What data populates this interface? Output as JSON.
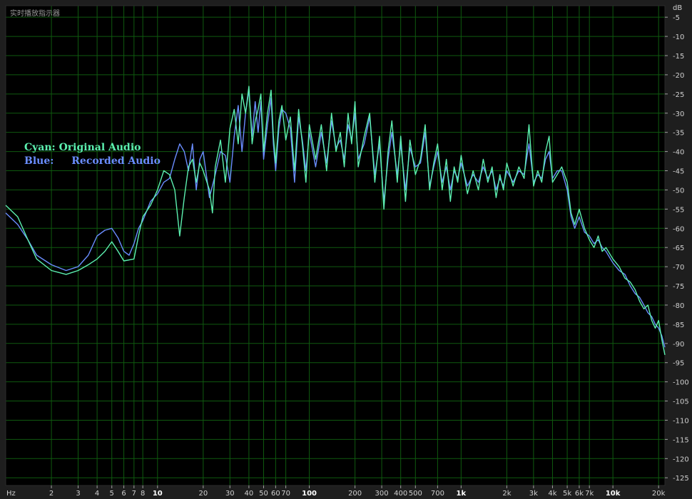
{
  "window": {
    "title": "实时播放指示器"
  },
  "legend": {
    "cyan_key": "Cyan:",
    "cyan_label": "Original Audio",
    "blue_key": "Blue:",
    "blue_label": "Recorded Audio"
  },
  "colors": {
    "cyan": "#5cf0b0",
    "blue": "#6a8dff",
    "grid": "#0f5a0f",
    "background": "#000000"
  },
  "chart_data": {
    "type": "line",
    "xscale": "log",
    "xunit": "Hz",
    "yunit": "dB",
    "xlim": [
      1,
      22000
    ],
    "ylim": [
      -127,
      -2
    ],
    "grid": true,
    "legend_position": "left",
    "x_ticks": [
      {
        "v": 2,
        "label": "2"
      },
      {
        "v": 3,
        "label": "3"
      },
      {
        "v": 4,
        "label": "4"
      },
      {
        "v": 5,
        "label": "5"
      },
      {
        "v": 6,
        "label": "6"
      },
      {
        "v": 7,
        "label": "7"
      },
      {
        "v": 8,
        "label": "8"
      },
      {
        "v": 10,
        "label": "10",
        "bold": true
      },
      {
        "v": 20,
        "label": "20"
      },
      {
        "v": 30,
        "label": "30"
      },
      {
        "v": 40,
        "label": "40"
      },
      {
        "v": 50,
        "label": "50"
      },
      {
        "v": 60,
        "label": "60"
      },
      {
        "v": 70,
        "label": "70"
      },
      {
        "v": 100,
        "label": "100",
        "bold": true
      },
      {
        "v": 200,
        "label": "200"
      },
      {
        "v": 300,
        "label": "300"
      },
      {
        "v": 400,
        "label": "400"
      },
      {
        "v": 500,
        "label": "500"
      },
      {
        "v": 700,
        "label": "700"
      },
      {
        "v": 1000,
        "label": "1k",
        "bold": true
      },
      {
        "v": 2000,
        "label": "2k"
      },
      {
        "v": 3000,
        "label": "3k"
      },
      {
        "v": 4000,
        "label": "4k"
      },
      {
        "v": 5000,
        "label": "5k"
      },
      {
        "v": 6000,
        "label": "6k"
      },
      {
        "v": 7000,
        "label": "7k"
      },
      {
        "v": 10000,
        "label": "10k",
        "bold": true
      },
      {
        "v": 20000,
        "label": "20k"
      }
    ],
    "y_ticks": [
      -5,
      -10,
      -15,
      -20,
      -25,
      -30,
      -35,
      -40,
      -45,
      -50,
      -55,
      -60,
      -65,
      -70,
      -75,
      -80,
      -85,
      -90,
      -95,
      -100,
      -105,
      -110,
      -115,
      -120,
      -125
    ],
    "series": [
      {
        "name": "Original Audio",
        "color": "#5cf0b0",
        "points": [
          [
            1,
            -54
          ],
          [
            1.2,
            -57
          ],
          [
            1.4,
            -63
          ],
          [
            1.6,
            -68
          ],
          [
            2,
            -71
          ],
          [
            2.5,
            -72
          ],
          [
            3,
            -71
          ],
          [
            3.5,
            -69.5
          ],
          [
            4,
            -68
          ],
          [
            4.5,
            -66
          ],
          [
            5,
            -63.5
          ],
          [
            5.5,
            -66
          ],
          [
            6,
            -68.5
          ],
          [
            7,
            -68
          ],
          [
            7.5,
            -62
          ],
          [
            8,
            -57
          ],
          [
            9,
            -54
          ],
          [
            10,
            -50
          ],
          [
            11,
            -45
          ],
          [
            12,
            -46
          ],
          [
            13,
            -50
          ],
          [
            14,
            -62
          ],
          [
            15,
            -52
          ],
          [
            16,
            -44
          ],
          [
            17,
            -42
          ],
          [
            18,
            -48
          ],
          [
            19,
            -43
          ],
          [
            20,
            -45
          ],
          [
            22,
            -50
          ],
          [
            23,
            -56
          ],
          [
            24,
            -44
          ],
          [
            26,
            -37
          ],
          [
            28,
            -48
          ],
          [
            30,
            -34
          ],
          [
            32,
            -29
          ],
          [
            34,
            -38
          ],
          [
            36,
            -25
          ],
          [
            38,
            -30
          ],
          [
            40,
            -23
          ],
          [
            42,
            -38
          ],
          [
            44,
            -32
          ],
          [
            46,
            -29
          ],
          [
            48,
            -25
          ],
          [
            50,
            -40
          ],
          [
            53,
            -30
          ],
          [
            56,
            -24
          ],
          [
            58,
            -36
          ],
          [
            60,
            -43
          ],
          [
            63,
            -32
          ],
          [
            66,
            -28
          ],
          [
            70,
            -37
          ],
          [
            75,
            -31
          ],
          [
            80,
            -45
          ],
          [
            85,
            -29
          ],
          [
            90,
            -38
          ],
          [
            95,
            -48
          ],
          [
            100,
            -33
          ],
          [
            110,
            -42
          ],
          [
            120,
            -33
          ],
          [
            130,
            -45
          ],
          [
            140,
            -30
          ],
          [
            150,
            -40
          ],
          [
            160,
            -35
          ],
          [
            170,
            -44
          ],
          [
            180,
            -30
          ],
          [
            190,
            -38
          ],
          [
            200,
            -27
          ],
          [
            210,
            -44
          ],
          [
            230,
            -36
          ],
          [
            250,
            -30
          ],
          [
            270,
            -48
          ],
          [
            290,
            -36
          ],
          [
            310,
            -55
          ],
          [
            330,
            -40
          ],
          [
            350,
            -32
          ],
          [
            380,
            -48
          ],
          [
            400,
            -36
          ],
          [
            430,
            -53
          ],
          [
            460,
            -37
          ],
          [
            500,
            -46
          ],
          [
            540,
            -42
          ],
          [
            580,
            -33
          ],
          [
            620,
            -50
          ],
          [
            660,
            -43
          ],
          [
            700,
            -38
          ],
          [
            750,
            -50
          ],
          [
            800,
            -42
          ],
          [
            850,
            -53
          ],
          [
            900,
            -44
          ],
          [
            950,
            -48
          ],
          [
            1000,
            -41
          ],
          [
            1100,
            -51
          ],
          [
            1200,
            -45
          ],
          [
            1300,
            -50
          ],
          [
            1400,
            -42
          ],
          [
            1500,
            -48
          ],
          [
            1600,
            -44
          ],
          [
            1700,
            -52
          ],
          [
            1800,
            -46
          ],
          [
            1900,
            -50
          ],
          [
            2000,
            -43
          ],
          [
            2200,
            -49
          ],
          [
            2400,
            -44
          ],
          [
            2600,
            -47
          ],
          [
            2800,
            -33
          ],
          [
            3000,
            -49
          ],
          [
            3200,
            -45
          ],
          [
            3400,
            -48
          ],
          [
            3600,
            -40
          ],
          [
            3800,
            -36
          ],
          [
            4000,
            -48
          ],
          [
            4300,
            -46
          ],
          [
            4600,
            -44
          ],
          [
            5000,
            -48
          ],
          [
            5300,
            -56
          ],
          [
            5600,
            -59
          ],
          [
            6000,
            -55
          ],
          [
            6500,
            -60
          ],
          [
            7000,
            -63
          ],
          [
            7500,
            -65
          ],
          [
            8000,
            -62
          ],
          [
            8500,
            -66
          ],
          [
            9000,
            -65
          ],
          [
            10000,
            -68
          ],
          [
            11000,
            -70
          ],
          [
            12000,
            -73
          ],
          [
            13000,
            -74
          ],
          [
            14000,
            -76
          ],
          [
            15000,
            -79
          ],
          [
            16000,
            -81
          ],
          [
            17000,
            -80
          ],
          [
            18000,
            -84
          ],
          [
            19000,
            -86
          ],
          [
            20000,
            -84
          ],
          [
            21000,
            -89
          ],
          [
            22000,
            -93
          ]
        ]
      },
      {
        "name": "Recorded Audio",
        "color": "#6a8dff",
        "points": [
          [
            1,
            -56
          ],
          [
            1.2,
            -59
          ],
          [
            1.4,
            -63
          ],
          [
            1.6,
            -67
          ],
          [
            2,
            -69.5
          ],
          [
            2.5,
            -71
          ],
          [
            3,
            -70
          ],
          [
            3.5,
            -67
          ],
          [
            4,
            -62
          ],
          [
            4.5,
            -60.5
          ],
          [
            5,
            -60
          ],
          [
            5.5,
            -62.5
          ],
          [
            6,
            -66
          ],
          [
            6.5,
            -67
          ],
          [
            7,
            -64
          ],
          [
            7.5,
            -60
          ],
          [
            8,
            -58
          ],
          [
            9,
            -53
          ],
          [
            10,
            -51
          ],
          [
            11,
            -48
          ],
          [
            12,
            -47
          ],
          [
            13,
            -42
          ],
          [
            14,
            -38
          ],
          [
            15,
            -40
          ],
          [
            16,
            -45
          ],
          [
            17,
            -38
          ],
          [
            18,
            -50
          ],
          [
            19,
            -42
          ],
          [
            20,
            -40
          ],
          [
            22,
            -52
          ],
          [
            24,
            -46
          ],
          [
            26,
            -40
          ],
          [
            28,
            -41
          ],
          [
            30,
            -48
          ],
          [
            32,
            -36
          ],
          [
            34,
            -28
          ],
          [
            36,
            -40
          ],
          [
            38,
            -30
          ],
          [
            40,
            -24
          ],
          [
            42,
            -36
          ],
          [
            44,
            -27
          ],
          [
            46,
            -35
          ],
          [
            48,
            -27
          ],
          [
            50,
            -42
          ],
          [
            53,
            -33
          ],
          [
            56,
            -26
          ],
          [
            58,
            -38
          ],
          [
            60,
            -45
          ],
          [
            63,
            -34
          ],
          [
            66,
            -29
          ],
          [
            70,
            -30
          ],
          [
            75,
            -34
          ],
          [
            80,
            -48
          ],
          [
            85,
            -31
          ],
          [
            90,
            -37
          ],
          [
            95,
            -45
          ],
          [
            100,
            -35
          ],
          [
            110,
            -44
          ],
          [
            120,
            -35
          ],
          [
            130,
            -43
          ],
          [
            140,
            -32
          ],
          [
            150,
            -39
          ],
          [
            160,
            -37
          ],
          [
            170,
            -42
          ],
          [
            180,
            -33
          ],
          [
            190,
            -37
          ],
          [
            200,
            -30
          ],
          [
            210,
            -42
          ],
          [
            230,
            -38
          ],
          [
            250,
            -31
          ],
          [
            270,
            -46
          ],
          [
            290,
            -38
          ],
          [
            310,
            -53
          ],
          [
            330,
            -42
          ],
          [
            350,
            -35
          ],
          [
            380,
            -46
          ],
          [
            400,
            -38
          ],
          [
            430,
            -50
          ],
          [
            460,
            -39
          ],
          [
            500,
            -44
          ],
          [
            540,
            -43
          ],
          [
            580,
            -35
          ],
          [
            620,
            -49
          ],
          [
            660,
            -44
          ],
          [
            700,
            -40
          ],
          [
            750,
            -48
          ],
          [
            800,
            -44
          ],
          [
            850,
            -50
          ],
          [
            900,
            -45
          ],
          [
            950,
            -47
          ],
          [
            1000,
            -43
          ],
          [
            1100,
            -49
          ],
          [
            1200,
            -46
          ],
          [
            1300,
            -48
          ],
          [
            1400,
            -44
          ],
          [
            1500,
            -47
          ],
          [
            1600,
            -45
          ],
          [
            1700,
            -50
          ],
          [
            1800,
            -47
          ],
          [
            1900,
            -49
          ],
          [
            2000,
            -45
          ],
          [
            2200,
            -48
          ],
          [
            2400,
            -45
          ],
          [
            2600,
            -46
          ],
          [
            2800,
            -38
          ],
          [
            3000,
            -48
          ],
          [
            3200,
            -46
          ],
          [
            3400,
            -47
          ],
          [
            3600,
            -42
          ],
          [
            3800,
            -40
          ],
          [
            4000,
            -47
          ],
          [
            4300,
            -45
          ],
          [
            4600,
            -45
          ],
          [
            5000,
            -50
          ],
          [
            5300,
            -57
          ],
          [
            5600,
            -60
          ],
          [
            6000,
            -57
          ],
          [
            6500,
            -61
          ],
          [
            7000,
            -62
          ],
          [
            7500,
            -64
          ],
          [
            8000,
            -63
          ],
          [
            8500,
            -65
          ],
          [
            9000,
            -66
          ],
          [
            10000,
            -69
          ],
          [
            11000,
            -71
          ],
          [
            12000,
            -72
          ],
          [
            13000,
            -75
          ],
          [
            14000,
            -77
          ],
          [
            15000,
            -78
          ],
          [
            16000,
            -80
          ],
          [
            17000,
            -82
          ],
          [
            18000,
            -83
          ],
          [
            19000,
            -85
          ],
          [
            20000,
            -86
          ],
          [
            21000,
            -88
          ],
          [
            22000,
            -91
          ]
        ]
      }
    ]
  }
}
